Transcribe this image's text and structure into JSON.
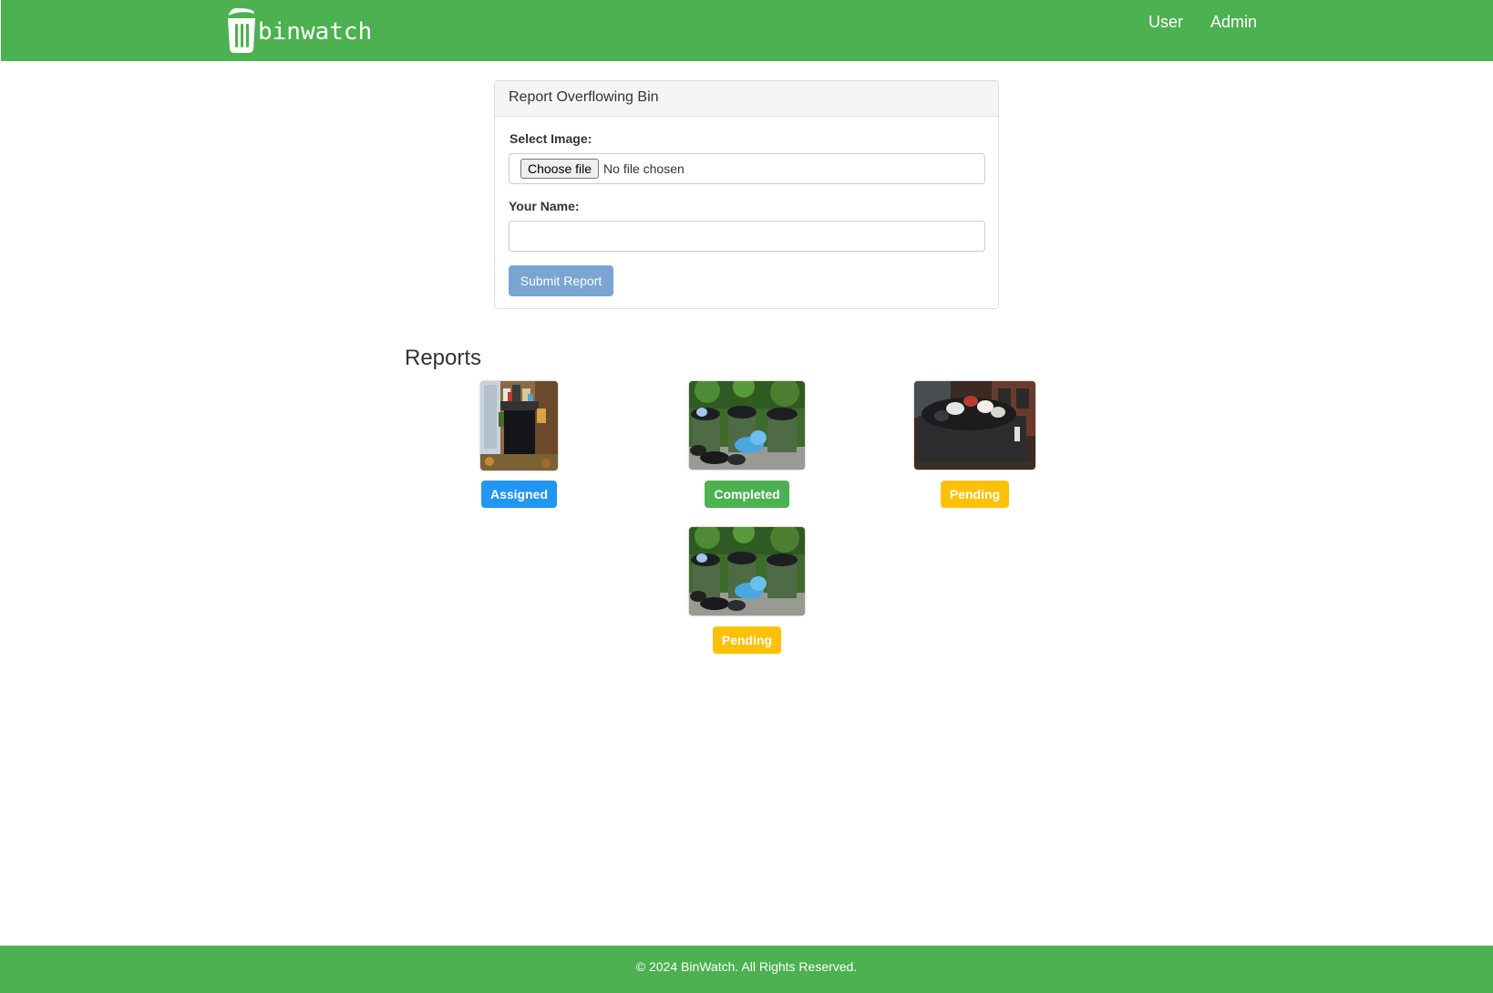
{
  "brand": {
    "name": "binwatch",
    "color": "#4CB150"
  },
  "nav": {
    "items": [
      {
        "label": "User"
      },
      {
        "label": "Admin"
      }
    ]
  },
  "report_form": {
    "title": "Report Overflowing Bin",
    "image_label": "Select Image:",
    "file_button_label": "Choose file",
    "file_status": "No file chosen",
    "name_label": "Your Name:",
    "name_value": "",
    "name_placeholder": "",
    "submit_label": "Submit Report"
  },
  "reports": {
    "title": "Reports",
    "items": [
      {
        "status": "Assigned",
        "status_color": "#2196F3",
        "image": "wheelie-bin-overflowing"
      },
      {
        "status": "Completed",
        "status_color": "#4CB150",
        "image": "green-dumpsters-with-bags"
      },
      {
        "status": "Pending",
        "status_color": "#FFC107",
        "image": "dark-skip-overflowing"
      },
      {
        "status": "Pending",
        "status_color": "#FFC107",
        "image": "green-dumpsters-with-bags"
      }
    ]
  },
  "footer": {
    "text": "© 2024 BinWatch. All Rights Reserved."
  }
}
